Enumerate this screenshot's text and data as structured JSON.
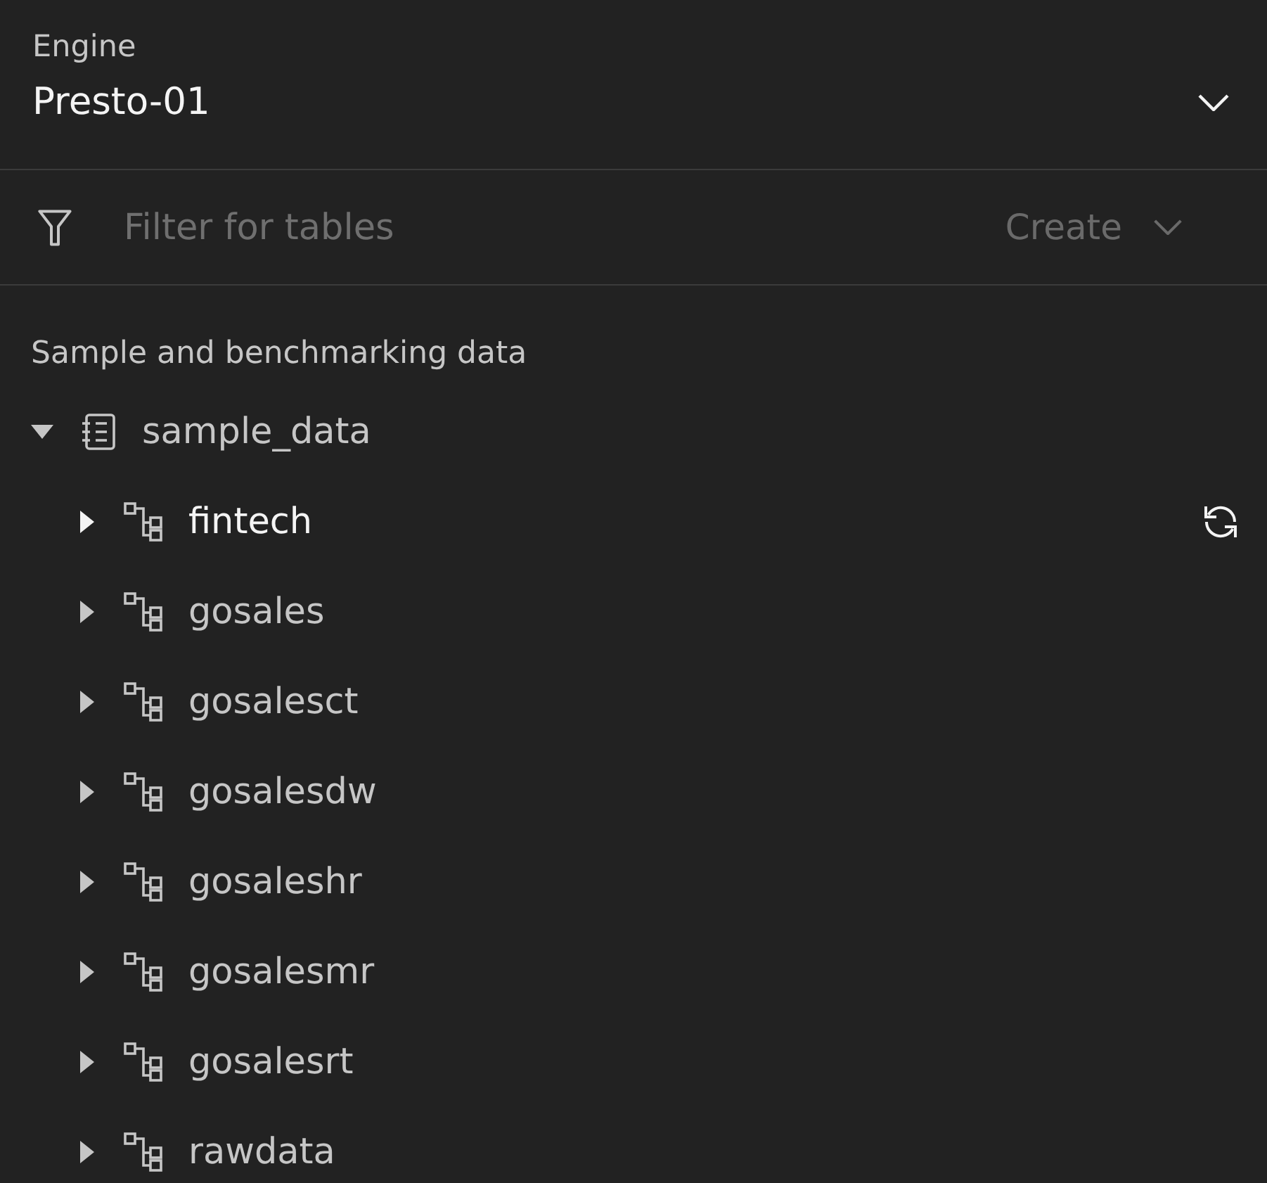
{
  "engine": {
    "label": "Engine",
    "value": "Presto-01"
  },
  "filter": {
    "placeholder": "Filter for tables"
  },
  "create_button": {
    "label": "Create",
    "disabled": true
  },
  "section_title": "Sample and benchmarking data",
  "tree": [
    {
      "label": "sample_data",
      "expanded": true,
      "hovered": false,
      "children": [
        {
          "label": "fintech",
          "expanded": false,
          "hovered": true
        },
        {
          "label": "gosales",
          "expanded": false,
          "hovered": false
        },
        {
          "label": "gosalesct",
          "expanded": false,
          "hovered": false
        },
        {
          "label": "gosalesdw",
          "expanded": false,
          "hovered": false
        },
        {
          "label": "gosaleshr",
          "expanded": false,
          "hovered": false
        },
        {
          "label": "gosalesmr",
          "expanded": false,
          "hovered": false
        },
        {
          "label": "gosalesrt",
          "expanded": false,
          "hovered": false
        },
        {
          "label": "rawdata",
          "expanded": false,
          "hovered": false
        }
      ]
    }
  ]
}
